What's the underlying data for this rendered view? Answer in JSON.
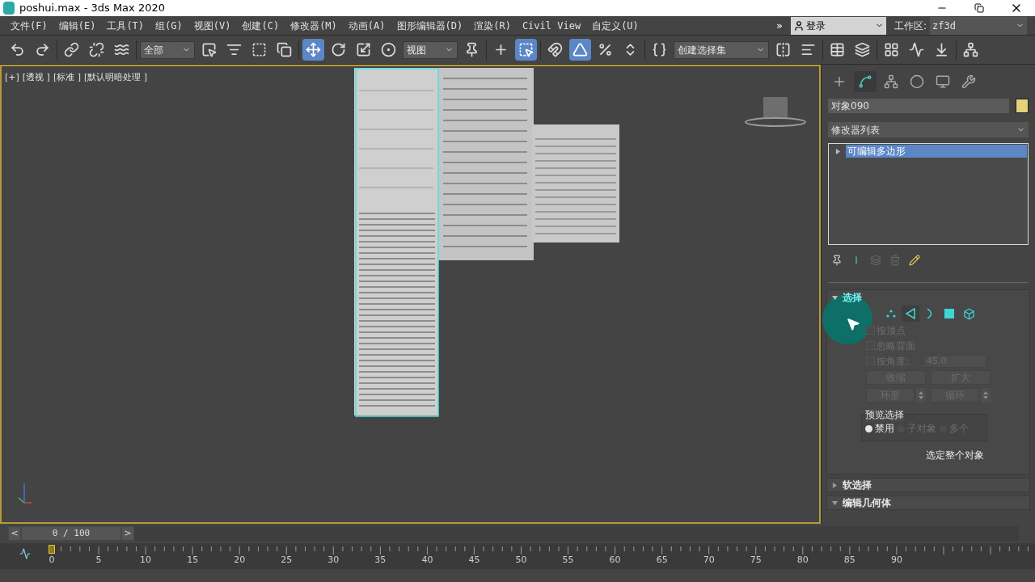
{
  "window": {
    "title": "poshui.max - 3ds Max 2020"
  },
  "menu": [
    "文件(F)",
    "编辑(E)",
    "工具(T)",
    "组(G)",
    "视图(V)",
    "创建(C)",
    "修改器(M)",
    "动画(A)",
    "图形编辑器(D)",
    "渲染(R)",
    "Civil View",
    "自定义(U)"
  ],
  "menu_overflow": "»",
  "sign_in": {
    "label": "登录"
  },
  "workspace": {
    "label": "工作区:",
    "value": "zf3d"
  },
  "toolbar": [
    {
      "kind": "icon",
      "active": false
    },
    {
      "kind": "icon",
      "active": false
    },
    {
      "kind": "sep"
    },
    {
      "kind": "icon",
      "active": false
    },
    {
      "kind": "icon",
      "active": false
    },
    {
      "kind": "icon",
      "active": false
    },
    {
      "kind": "sep"
    },
    {
      "kind": "dropdown",
      "value": "全部"
    },
    {
      "kind": "icon",
      "active": false
    },
    {
      "kind": "icon",
      "active": false
    },
    {
      "kind": "icon",
      "active": false
    },
    {
      "kind": "icon",
      "active": false
    },
    {
      "kind": "sep"
    },
    {
      "kind": "icon",
      "active": true
    },
    {
      "kind": "icon",
      "active": false
    },
    {
      "kind": "icon",
      "active": false
    },
    {
      "kind": "icon",
      "active": false
    },
    {
      "kind": "dropdown",
      "value": "视图"
    },
    {
      "kind": "icon",
      "active": false
    },
    {
      "kind": "sep"
    },
    {
      "kind": "icon",
      "active": false
    },
    {
      "kind": "icon",
      "active": true
    },
    {
      "kind": "sep"
    },
    {
      "kind": "icon",
      "active": false
    },
    {
      "kind": "icon",
      "active": true
    },
    {
      "kind": "icon",
      "active": false
    },
    {
      "kind": "icon",
      "active": false
    },
    {
      "kind": "sep"
    },
    {
      "kind": "icon",
      "active": false
    },
    {
      "kind": "dropdown",
      "value": "创建选择集"
    },
    {
      "kind": "icon",
      "active": false
    },
    {
      "kind": "icon",
      "active": false
    },
    {
      "kind": "sep"
    },
    {
      "kind": "icon",
      "active": false
    },
    {
      "kind": "icon",
      "active": false
    },
    {
      "kind": "sep"
    },
    {
      "kind": "icon",
      "active": false
    },
    {
      "kind": "icon",
      "active": false
    },
    {
      "kind": "icon",
      "active": false
    },
    {
      "kind": "sep"
    },
    {
      "kind": "icon",
      "active": false
    }
  ],
  "viewport": {
    "labels": [
      "[+]",
      "[透视 ]",
      "[标准 ]",
      "[默认明暗处理 ]"
    ]
  },
  "command_panel": {
    "tabs": [
      {
        "selected": false
      },
      {
        "selected": true
      },
      {
        "selected": false
      },
      {
        "selected": false
      },
      {
        "selected": false
      },
      {
        "selected": false
      }
    ],
    "object_name": "对象090",
    "modifier_list": "修改器列表",
    "stack": [
      {
        "label": "可编辑多边形",
        "selected": true,
        "expanded": false
      }
    ],
    "rollouts": [
      {
        "kind": "selection",
        "title": "选择",
        "expanded": true,
        "options": [
          {
            "label": "按顶点",
            "checked": false,
            "disabled": true
          },
          {
            "label": "忽略背面",
            "checked": false,
            "disabled": true
          },
          {
            "label": "按角度:",
            "checked": false,
            "disabled": true,
            "value": "45.0"
          }
        ],
        "buttons": [
          {
            "label": "收缩",
            "spinner": false
          },
          {
            "label": "扩大",
            "spinner": false
          },
          {
            "label": "环形",
            "spinner": true
          },
          {
            "label": "循环",
            "spinner": true
          }
        ],
        "preview": {
          "title": "预览选择",
          "choices": [
            {
              "label": "禁用",
              "selected": true,
              "disabled": false
            },
            {
              "label": "子对象",
              "selected": false,
              "disabled": true
            },
            {
              "label": "多个",
              "selected": false,
              "disabled": true
            }
          ]
        },
        "status": "选定整个对象"
      },
      {
        "kind": "header",
        "title": "软选择",
        "expanded": false
      },
      {
        "kind": "header",
        "title": "编辑几何体",
        "expanded": true
      }
    ]
  },
  "time_slider": {
    "value": "0 / 100",
    "prev": "<",
    "next": ">",
    "level": 0
  },
  "timeline": {
    "ticks": [
      "0",
      "5",
      "10",
      "15",
      "20",
      "25",
      "30",
      "35",
      "40",
      "45",
      "50",
      "55",
      "60",
      "65",
      "70",
      "75",
      "80",
      "85",
      "90"
    ]
  }
}
